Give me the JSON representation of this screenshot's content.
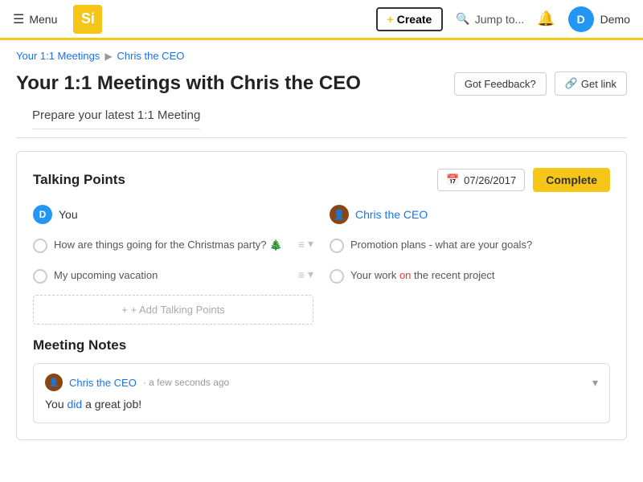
{
  "header": {
    "menu_label": "Menu",
    "logo_text": "Si",
    "create_label": "+ Create",
    "create_plus": "+",
    "create_text": "Create",
    "jump_label": "Jump to...",
    "username": "Demo",
    "avatar_letter": "D"
  },
  "breadcrumb": {
    "parent": "Your 1:1 Meetings",
    "separator": "▶",
    "current": "Chris the CEO"
  },
  "page": {
    "title_prefix": "Your 1:1 Meetings with",
    "title_name": "Chris the CEO",
    "full_title": "Your 1:1 Meetings with Chris the CEO",
    "feedback_label": "Got Feedback?",
    "getlink_label": "🔗 Get link",
    "prepare_label": "Prepare your latest 1:1 Meeting"
  },
  "talking_points": {
    "title": "Talking Points",
    "date": "07/26/2017",
    "complete_label": "Complete",
    "you_label": "You",
    "you_avatar": "D",
    "your_items": [
      {
        "text": "How are things going for the Christmas party? 🎄"
      },
      {
        "text": "My upcoming vacation"
      }
    ],
    "add_label": "+ Add Talking Points",
    "ceo_name": "Chris the CEO",
    "ceo_avatar": "👤",
    "ceo_items": [
      {
        "text": "Promotion plans - what are your goals?"
      },
      {
        "text": "Your work on the recent project",
        "highlight_word": "on"
      }
    ]
  },
  "meeting_notes": {
    "title": "Meeting Notes",
    "note": {
      "author_name": "Chris the CEO",
      "author_avatar": "👤",
      "time": "a few seconds ago",
      "text_before": "You ",
      "text_highlight": "did",
      "text_after": " a great job!"
    }
  }
}
